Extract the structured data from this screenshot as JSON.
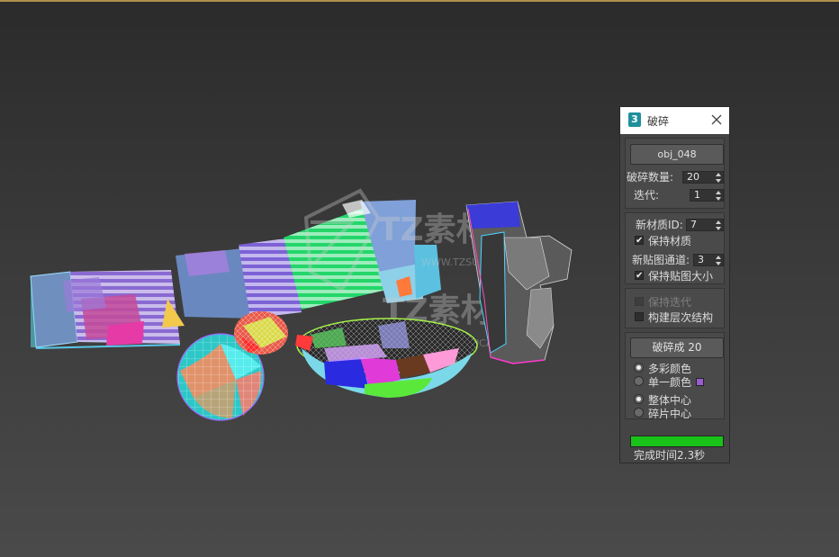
{
  "panel": {
    "title": "破碎",
    "app_icon_label": "3",
    "object_button_label": "obj_048",
    "fracture_count_label": "破碎数量:",
    "fracture_count_value": "20",
    "iterations_label": "迭代:",
    "iterations_value": "1",
    "new_material_id_label": "新材质ID:",
    "new_material_id_value": "7",
    "keep_material_label": "保持材质",
    "keep_material_checked": true,
    "new_map_channel_label": "新贴图通道:",
    "new_map_channel_value": "3",
    "keep_map_size_label": "保持贴图大小",
    "keep_map_size_checked": true,
    "keep_iterations_label": "保持迭代",
    "keep_iterations_checked": false,
    "build_hierarchy_label": "构建层次结构",
    "build_hierarchy_checked": false,
    "fracture_button_label": "破碎成 20",
    "multicolor_label": "多彩颜色",
    "single_color_label": "单一颜色",
    "color_mode": "multicolor",
    "single_color_swatch": "#9a5cd0",
    "whole_center_label": "整体中心",
    "piece_center_label": "碎片中心",
    "pivot_mode": "whole",
    "progress": 1.0,
    "progress_color": "#19c219",
    "status_text": "完成时间2.3秒"
  },
  "viewport": {
    "watermark_text": "TZ素材网",
    "watermark_url": "WWW.TZSUCAI.COM",
    "accent_color": "#b0914a"
  }
}
